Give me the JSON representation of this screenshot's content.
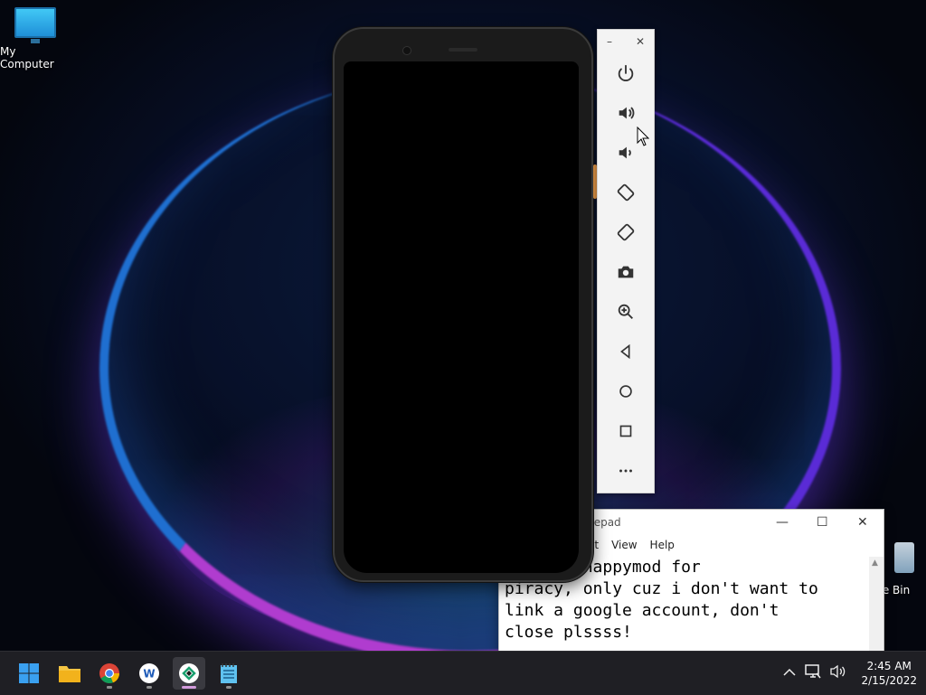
{
  "desktop": {
    "icons": [
      {
        "label": "My Computer"
      },
      {
        "label": "e Bin"
      }
    ]
  },
  "emulator_toolbar": {
    "window_controls": {
      "minimize": "–",
      "close": "✕"
    },
    "buttons": [
      "power-icon",
      "volume-up-icon",
      "volume-down-icon",
      "rotate-left-icon",
      "rotate-right-icon",
      "screenshot-icon",
      "zoom-icon",
      "back-icon",
      "home-icon",
      "overview-icon",
      "more-icon"
    ]
  },
  "notepad": {
    "title": "tepad",
    "menu": [
      "at",
      "View",
      "Help"
    ],
    "controls": {
      "minimize": "—",
      "maximize": "☐",
      "close": "✕"
    },
    "text": "t using happymod for\npiracy, only cuz i don't want to\nlink a google account, don't\nclose plssss!"
  },
  "taskbar": {
    "apps": [
      {
        "name": "start",
        "active": false
      },
      {
        "name": "file-explorer",
        "active": false
      },
      {
        "name": "chrome",
        "active": false
      },
      {
        "name": "app-w",
        "active": false
      },
      {
        "name": "emulator",
        "active": true
      },
      {
        "name": "notepad",
        "active": false
      }
    ],
    "clock": {
      "time": "2:45 AM",
      "date": "2/15/2022"
    },
    "tray": {
      "chevron": "^"
    }
  },
  "colors": {
    "accent_pink": "#d39bdc",
    "wallpaper_ring": "#b03ccf"
  }
}
